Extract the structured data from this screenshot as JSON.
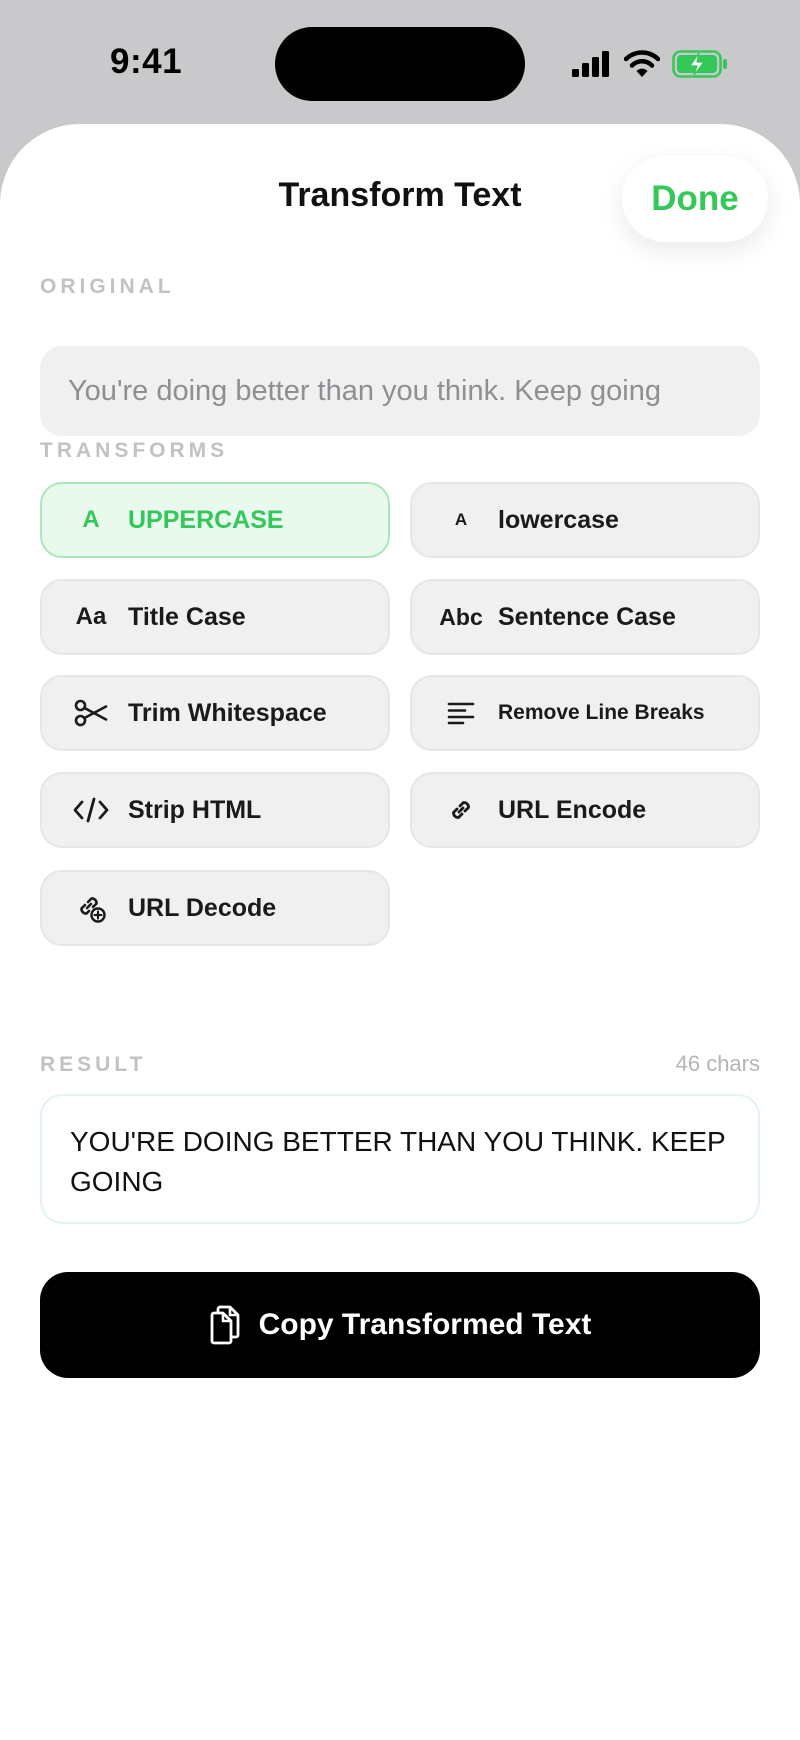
{
  "status_bar": {
    "time": "9:41",
    "icons": [
      "cellular-signal-icon",
      "wifi-icon",
      "battery-charging-icon"
    ]
  },
  "sheet": {
    "title": "Transform Text",
    "done_label": "Done"
  },
  "original": {
    "label": "ORIGINAL",
    "text": "You're doing better than you think. Keep going"
  },
  "transforms": {
    "label": "TRANSFORMS",
    "items": [
      {
        "icon_text": "A",
        "label": "UPPERCASE",
        "active": true
      },
      {
        "icon_text": "A",
        "label": "lowercase",
        "active": false
      },
      {
        "icon_text": "Aa",
        "label": "Title Case",
        "active": false
      },
      {
        "icon_text": "Abc",
        "label": "Sentence Case",
        "active": false
      },
      {
        "icon": "scissors-icon",
        "label": "Trim Whitespace",
        "active": false
      },
      {
        "icon": "align-left-lines-icon",
        "label": "Remove Line Breaks",
        "active": false
      },
      {
        "icon": "code-brackets-icon",
        "label": "Strip HTML",
        "active": false
      },
      {
        "icon": "link-icon",
        "label": "URL Encode",
        "active": false
      },
      {
        "icon": "link-badge-icon",
        "label": "URL Decode",
        "active": false
      }
    ]
  },
  "result": {
    "label": "RESULT",
    "char_count": "46 chars",
    "text": "YOU'RE DOING BETTER THAN YOU THINK. KEEP GOING"
  },
  "copy_button": {
    "label": "Copy Transformed Text",
    "icon": "copy-document-icon"
  },
  "colors": {
    "accent": "#34c759",
    "active_bg": "#eaf9ee",
    "button_bg": "#f0f0f1",
    "primary_button": "#000000"
  }
}
